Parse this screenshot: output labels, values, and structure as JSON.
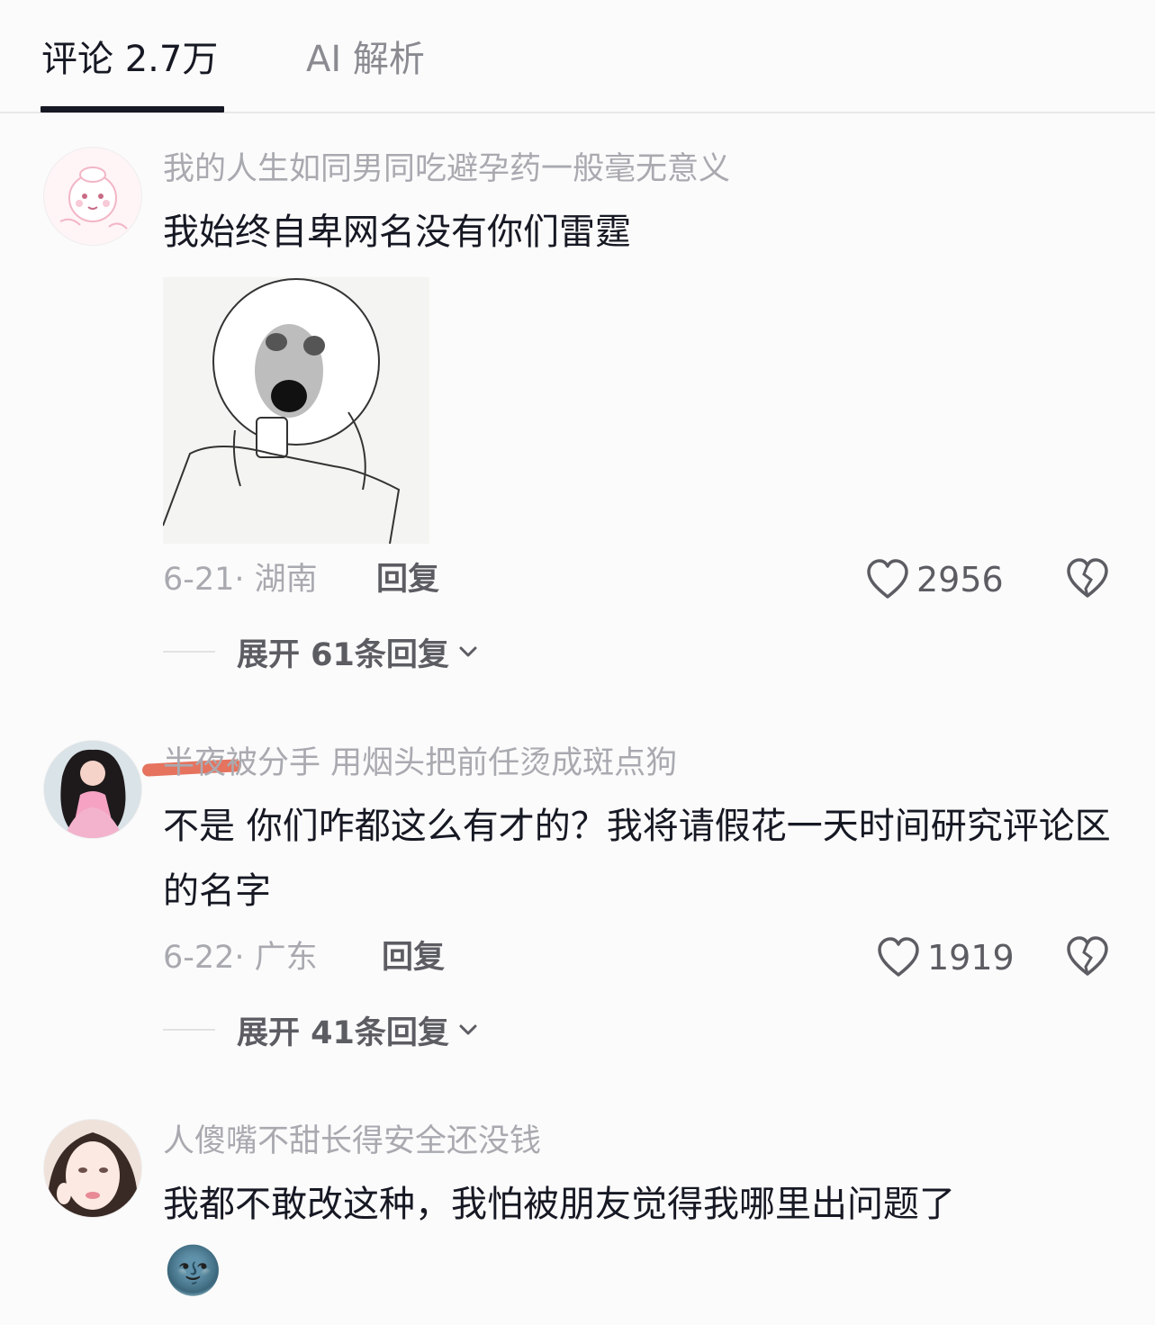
{
  "tabs": {
    "comments_label": "评论 2.7万",
    "ai_label": "AI 解析"
  },
  "comments": [
    {
      "username": "我的人生如同男同吃避孕药一般毫无意义",
      "text": "我始终自卑网名没有你们雷霆",
      "date_location": "6-21· 湖南",
      "reply_label": "回复",
      "likes": "2956",
      "expand_label": "展开 61条回复",
      "has_image": true,
      "image_description": "meme-sticker"
    },
    {
      "username": "半夜被分手 用烟头把前任烫成斑点狗",
      "text": "不是 你们咋都这么有才的？我将请假花一天时间研究评论区的名字",
      "date_location": "6-22· 广东",
      "reply_label": "回复",
      "likes": "1919",
      "expand_label": "展开 41条回复"
    },
    {
      "username": "人傻嘴不甜长得安全还没钱",
      "text": "我都不敢改这种，我怕被朋友觉得我哪里出问题了",
      "emoji": "🌚"
    }
  ],
  "colors": {
    "primary_text": "#161823",
    "secondary_text": "#a9aab0",
    "accent_underline": "#161823",
    "strike_mark": "#e05a42"
  }
}
